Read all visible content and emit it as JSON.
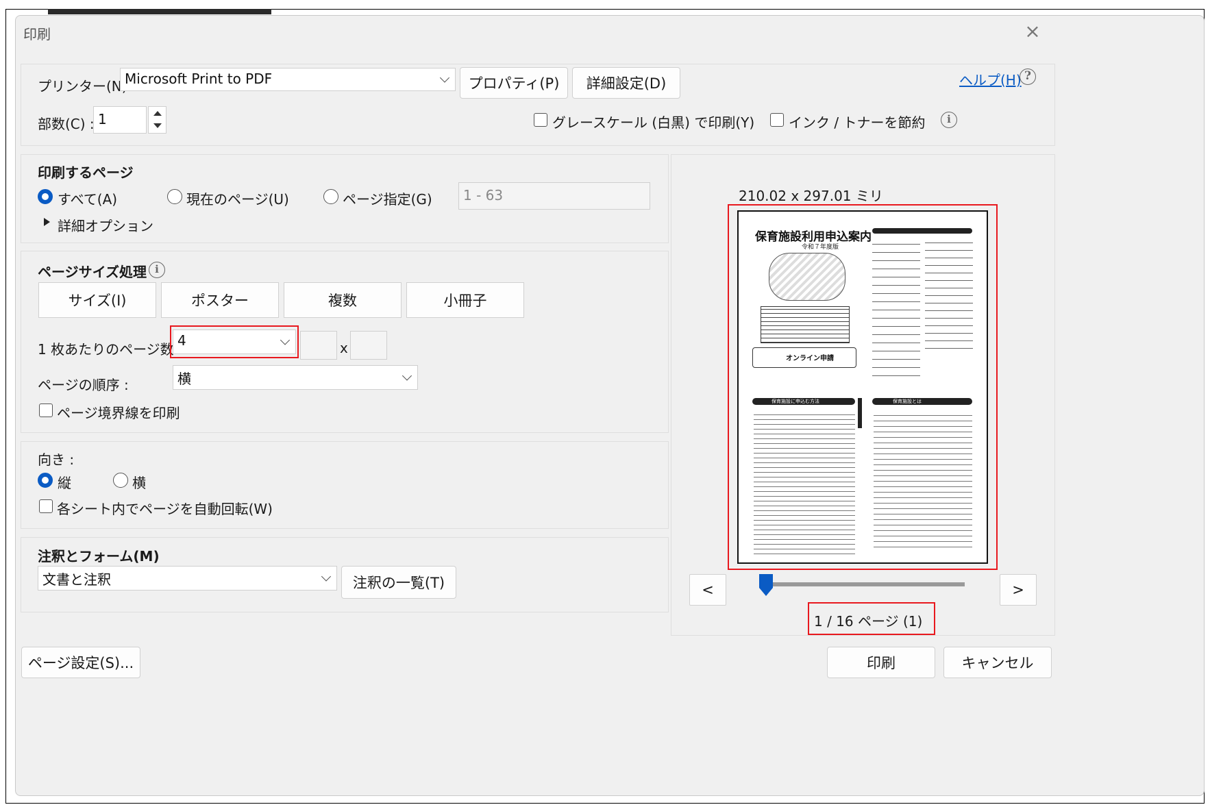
{
  "window": {
    "title": "印刷"
  },
  "printer": {
    "label": "プリンター(N) :",
    "selected": "Microsoft Print to PDF",
    "properties_label": "プロパティ(P)",
    "advanced_label": "詳細設定(D)",
    "help_label": "ヘルプ(H)"
  },
  "copies": {
    "label": "部数(C) :",
    "value": "1"
  },
  "options": {
    "grayscale_label": "グレースケール (白黒) で印刷(Y)",
    "save_ink_label": "インク / トナーを節約"
  },
  "pages_to_print": {
    "heading": "印刷するページ",
    "all_label": "すべて(A)",
    "current_label": "現在のページ(U)",
    "specify_label": "ページ指定(G)",
    "range_placeholder": "1 - 63",
    "more_options_label": "詳細オプション"
  },
  "page_sizing": {
    "heading": "ページサイズ処理",
    "tabs": [
      "サイズ(I)",
      "ポスター",
      "複数",
      "小冊子"
    ],
    "pages_per_sheet_label": "1 枚あたりのページ数 :",
    "pages_per_sheet_value": "4",
    "x_label": "x",
    "page_order_label": "ページの順序 :",
    "page_order_value": "横",
    "print_border_label": "ページ境界線を印刷"
  },
  "orientation": {
    "heading": "向き :",
    "portrait_label": "縦",
    "landscape_label": "横",
    "auto_rotate_label": "各シート内でページを自動回転(W)"
  },
  "comments_forms": {
    "heading": "注釈とフォーム(M)",
    "selected": "文書と注釈",
    "summary_label": "注釈の一覧(T)"
  },
  "preview": {
    "dimensions": "210.02 x 297.01 ミリ",
    "prev_label": "<",
    "next_label": ">",
    "page_indicator": "1 / 16 ページ (1)",
    "slider_position": 0,
    "thumb_title": "保育施設利用申込案内",
    "thumb_subtitle": "令和７年度版",
    "thumb_online": "オンライン申請",
    "thumb_section1": "保育施設に申込む方法",
    "thumb_section2": "保育施設とは"
  },
  "footer": {
    "page_setup_label": "ページ設定(S)...",
    "print_label": "印刷",
    "cancel_label": "キャンセル"
  }
}
